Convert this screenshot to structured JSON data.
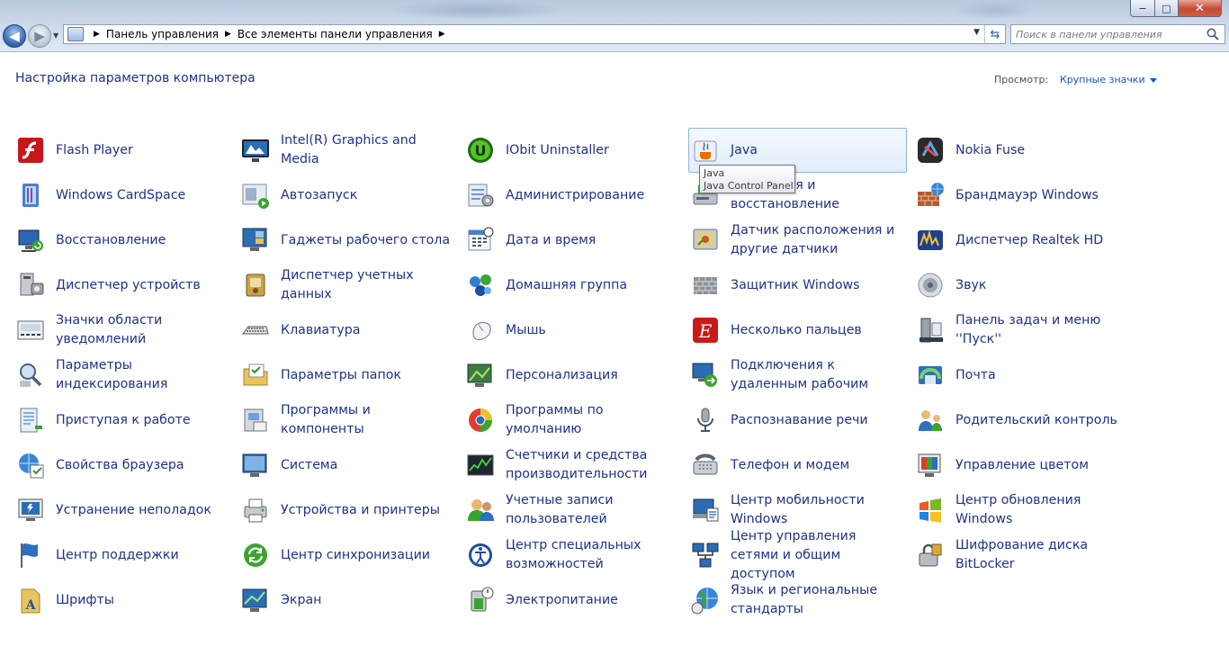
{
  "window": {
    "breadcrumb": [
      "Панель управления",
      "Все элементы панели управления"
    ],
    "search_placeholder": "Поиск в панели управления",
    "caption": {
      "minimize": "−",
      "maximize": "□",
      "close": "✕"
    }
  },
  "header": {
    "title": "Настройка параметров компьютера",
    "view_label": "Просмотр:",
    "view_value": "Крупные значки"
  },
  "tooltip": {
    "line1": "Java",
    "line2": "Java Control Panel"
  },
  "items": [
    {
      "label": "Flash Player",
      "icon": "flash-player-icon"
    },
    {
      "label": "Intel(R) Graphics and Media",
      "icon": "intel-graphics-icon"
    },
    {
      "label": "IObit Uninstaller",
      "icon": "iobit-uninstaller-icon"
    },
    {
      "label": "Java",
      "icon": "java-icon"
    },
    {
      "label": "Nokia Fuse",
      "icon": "nokia-fuse-icon"
    },
    {
      "label": "Windows CardSpace",
      "icon": "cardspace-icon"
    },
    {
      "label": "Автозапуск",
      "icon": "autoplay-icon"
    },
    {
      "label": "Администрирование",
      "icon": "admin-tools-icon"
    },
    {
      "label": "Архивация и восстановление",
      "icon": "backup-restore-icon"
    },
    {
      "label": "Брандмауэр Windows",
      "icon": "firewall-icon"
    },
    {
      "label": "Восстановление",
      "icon": "recovery-icon"
    },
    {
      "label": "Гаджеты рабочего стола",
      "icon": "gadgets-icon"
    },
    {
      "label": "Дата и время",
      "icon": "date-time-icon"
    },
    {
      "label": "Датчик расположения и другие датчики",
      "icon": "location-sensors-icon"
    },
    {
      "label": "Диспетчер Realtek HD",
      "icon": "realtek-icon"
    },
    {
      "label": "Диспетчер устройств",
      "icon": "device-manager-icon"
    },
    {
      "label": "Диспетчер учетных данных",
      "icon": "credential-manager-icon"
    },
    {
      "label": "Домашняя группа",
      "icon": "homegroup-icon"
    },
    {
      "label": "Защитник Windows",
      "icon": "defender-icon"
    },
    {
      "label": "Звук",
      "icon": "sound-icon"
    },
    {
      "label": "Значки области уведомлений",
      "icon": "notification-icons-icon"
    },
    {
      "label": "Клавиатура",
      "icon": "keyboard-icon"
    },
    {
      "label": "Мышь",
      "icon": "mouse-icon"
    },
    {
      "label": "Несколько пальцев",
      "icon": "multi-finger-icon"
    },
    {
      "label": "Панель задач и меню ''Пуск''",
      "icon": "taskbar-start-icon"
    },
    {
      "label": "Параметры индексирования",
      "icon": "indexing-icon"
    },
    {
      "label": "Параметры папок",
      "icon": "folder-options-icon"
    },
    {
      "label": "Персонализация",
      "icon": "personalization-icon"
    },
    {
      "label": "Подключения к удаленным рабочим",
      "icon": "remote-desktop-icon"
    },
    {
      "label": "Почта",
      "icon": "mail-icon"
    },
    {
      "label": "Приступая к работе",
      "icon": "getting-started-icon"
    },
    {
      "label": "Программы и компоненты",
      "icon": "programs-features-icon"
    },
    {
      "label": "Программы по умолчанию",
      "icon": "default-programs-icon"
    },
    {
      "label": "Распознавание речи",
      "icon": "speech-recognition-icon"
    },
    {
      "label": "Родительский контроль",
      "icon": "parental-controls-icon"
    },
    {
      "label": "Свойства браузера",
      "icon": "internet-options-icon"
    },
    {
      "label": "Система",
      "icon": "system-icon"
    },
    {
      "label": "Счетчики и средства производительности",
      "icon": "performance-icon"
    },
    {
      "label": "Телефон и модем",
      "icon": "phone-modem-icon"
    },
    {
      "label": "Управление цветом",
      "icon": "color-management-icon"
    },
    {
      "label": "Устранение неполадок",
      "icon": "troubleshooting-icon"
    },
    {
      "label": "Устройства и принтеры",
      "icon": "devices-printers-icon"
    },
    {
      "label": "Учетные записи пользователей",
      "icon": "user-accounts-icon"
    },
    {
      "label": "Центр мобильности Windows",
      "icon": "mobility-center-icon"
    },
    {
      "label": "Центр обновления Windows",
      "icon": "windows-update-icon"
    },
    {
      "label": "Центр поддержки",
      "icon": "action-center-icon"
    },
    {
      "label": "Центр синхронизации",
      "icon": "sync-center-icon"
    },
    {
      "label": "Центр специальных возможностей",
      "icon": "ease-of-access-icon"
    },
    {
      "label": "Центр управления сетями и общим доступом",
      "icon": "network-sharing-icon"
    },
    {
      "label": "Шифрование диска BitLocker",
      "icon": "bitlocker-icon"
    },
    {
      "label": "Шрифты",
      "icon": "fonts-icon"
    },
    {
      "label": "Экран",
      "icon": "display-icon"
    },
    {
      "label": "Электропитание",
      "icon": "power-options-icon"
    },
    {
      "label": "Язык и региональные стандарты",
      "icon": "region-language-icon"
    }
  ]
}
